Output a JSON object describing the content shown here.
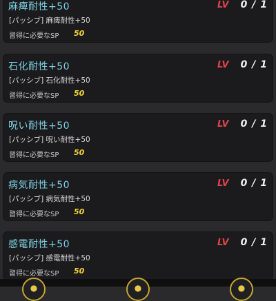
{
  "skills": [
    {
      "name": "麻痺耐性+50",
      "lv_label": "LV",
      "level": "0 / 1",
      "desc": "[パッシブ] 麻痺耐性+50",
      "sp_label": "習得に必要なSP",
      "sp_value": "50"
    },
    {
      "name": "石化耐性+50",
      "lv_label": "LV",
      "level": "0 / 1",
      "desc": "[パッシブ] 石化耐性+50",
      "sp_label": "習得に必要なSP",
      "sp_value": "50"
    },
    {
      "name": "呪い耐性+50",
      "lv_label": "LV",
      "level": "0 / 1",
      "desc": "[パッシブ] 呪い耐性+50",
      "sp_label": "習得に必要なSP",
      "sp_value": "50"
    },
    {
      "name": "病気耐性+50",
      "lv_label": "LV",
      "level": "0 / 1",
      "desc": "[パッシブ] 病気耐性+50",
      "sp_label": "習得に必要なSP",
      "sp_value": "50"
    },
    {
      "name": "感電耐性+50",
      "lv_label": "LV",
      "level": "0 / 1",
      "desc": "[パッシブ] 感電耐性+50",
      "sp_label": "習得に必要なSP",
      "sp_value": "50"
    }
  ],
  "colors": {
    "title": "#7fd0e4",
    "lv": "#e0434a",
    "sp_value": "#f2d33a",
    "card_bg": "#1b1b1d",
    "page_bg": "#2a2a2c"
  },
  "bottom_buttons": [
    {
      "icon": "gold-ring-button-icon"
    },
    {
      "icon": "gold-ring-button-icon"
    },
    {
      "icon": "gold-ring-button-icon"
    }
  ]
}
